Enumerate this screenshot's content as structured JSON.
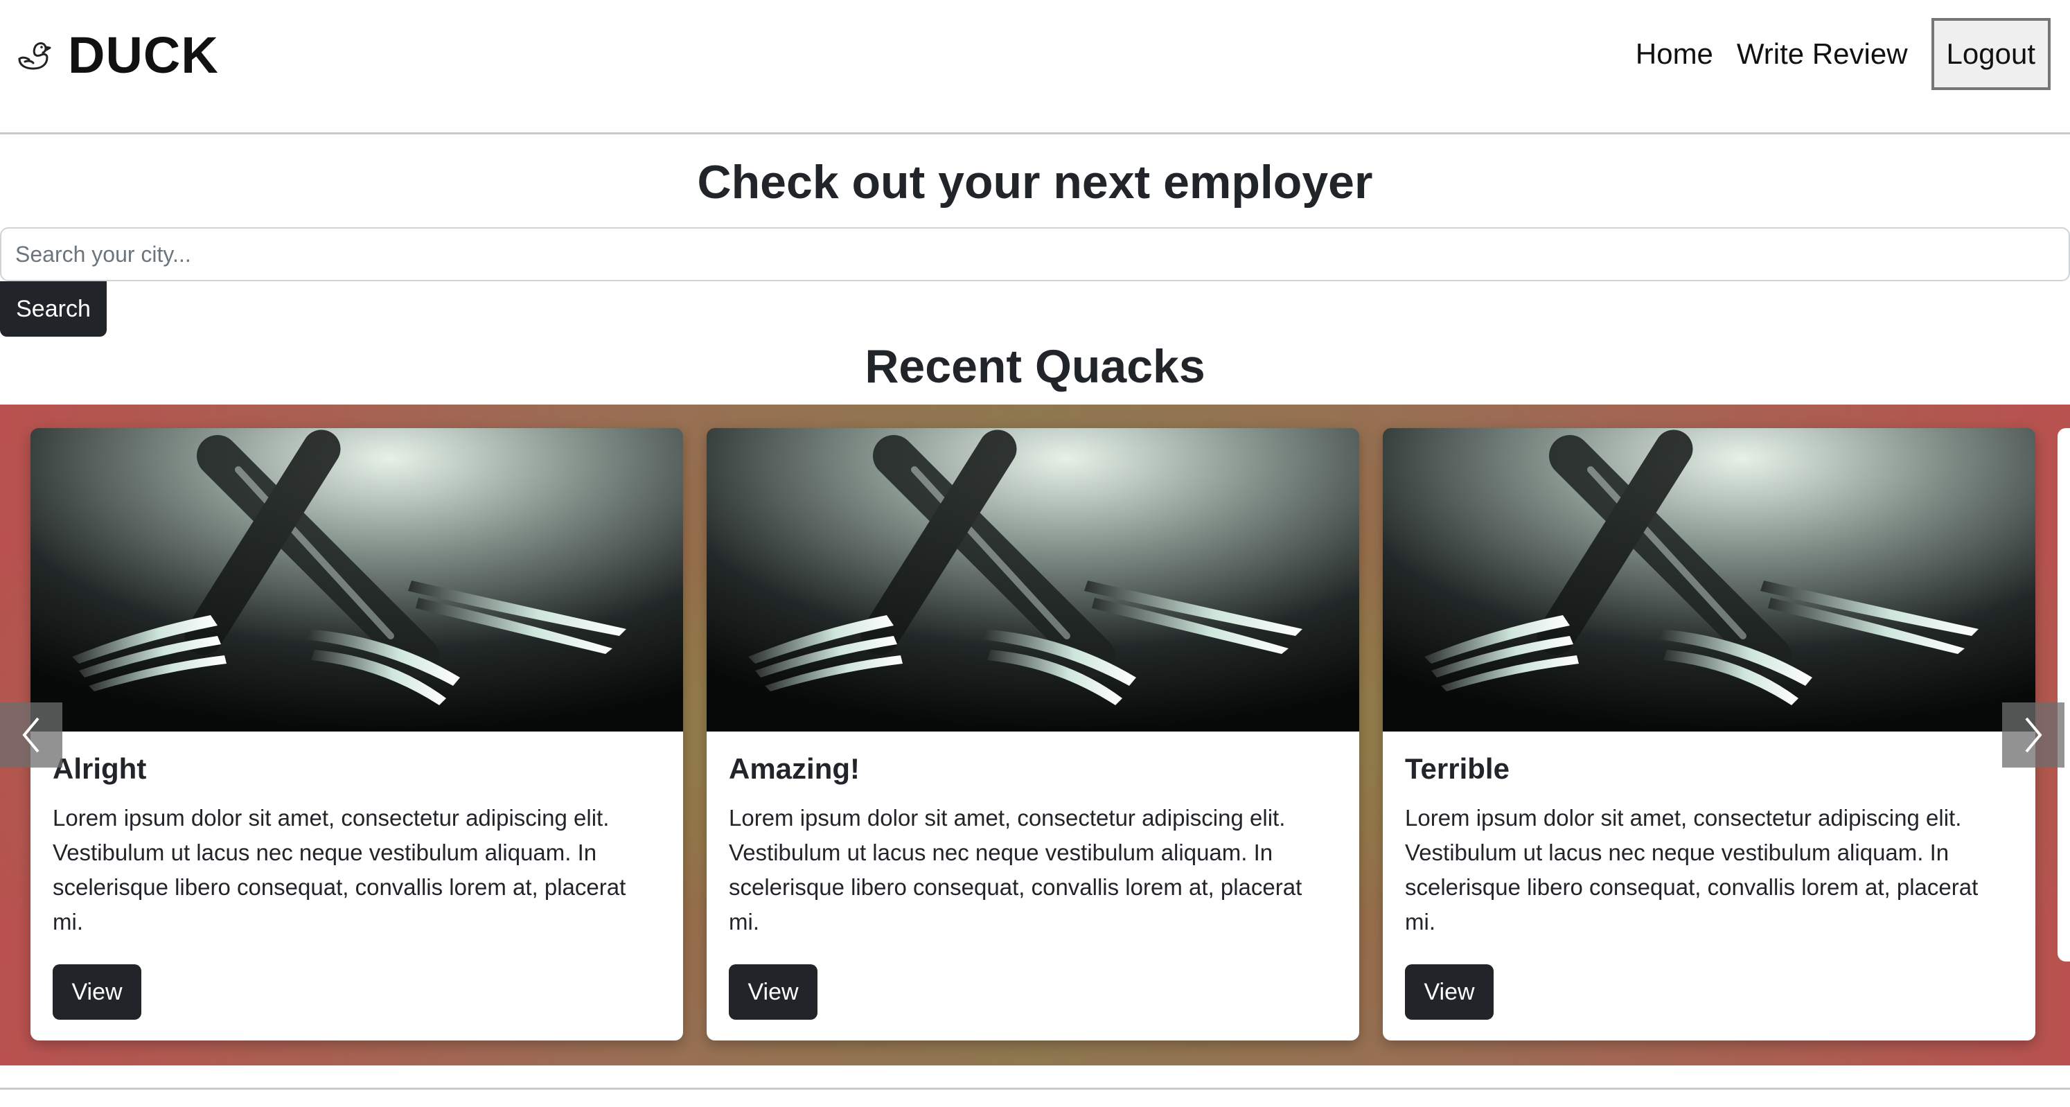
{
  "header": {
    "brand_icon": "rubber-duck-icon",
    "brand_name": "DUCK",
    "nav": {
      "home": "Home",
      "write_review": "Write Review",
      "logout": "Logout"
    }
  },
  "hero": {
    "title": "Check out your next employer",
    "search_placeholder": "Search your city...",
    "search_value": "",
    "search_button": "Search"
  },
  "recent": {
    "title": "Recent Quacks",
    "cards": [
      {
        "image": "forks-photo",
        "title": "Alright",
        "text": "Lorem ipsum dolor sit amet, consectetur adipiscing elit. Vestibulum ut lacus nec neque vestibulum aliquam. In scelerisque libero consequat, convallis lorem at, placerat mi.",
        "button": "View"
      },
      {
        "image": "forks-photo",
        "title": "Amazing!",
        "text": "Lorem ipsum dolor sit amet, consectetur adipiscing elit. Vestibulum ut lacus nec neque vestibulum aliquam. In scelerisque libero consequat, convallis lorem at, placerat mi.",
        "button": "View"
      },
      {
        "image": "forks-photo",
        "title": "Terrible",
        "text": "Lorem ipsum dolor sit amet, consectetur adipiscing elit. Vestibulum ut lacus nec neque vestibulum aliquam. In scelerisque libero consequat, convallis lorem at, placerat mi.",
        "button": "View"
      }
    ],
    "prev_icon": "chevron-left-icon",
    "next_icon": "chevron-right-icon"
  },
  "colors": {
    "primary_dark": "#212529",
    "carousel_red": "#b8514f",
    "carousel_olive": "#8c7a52"
  }
}
